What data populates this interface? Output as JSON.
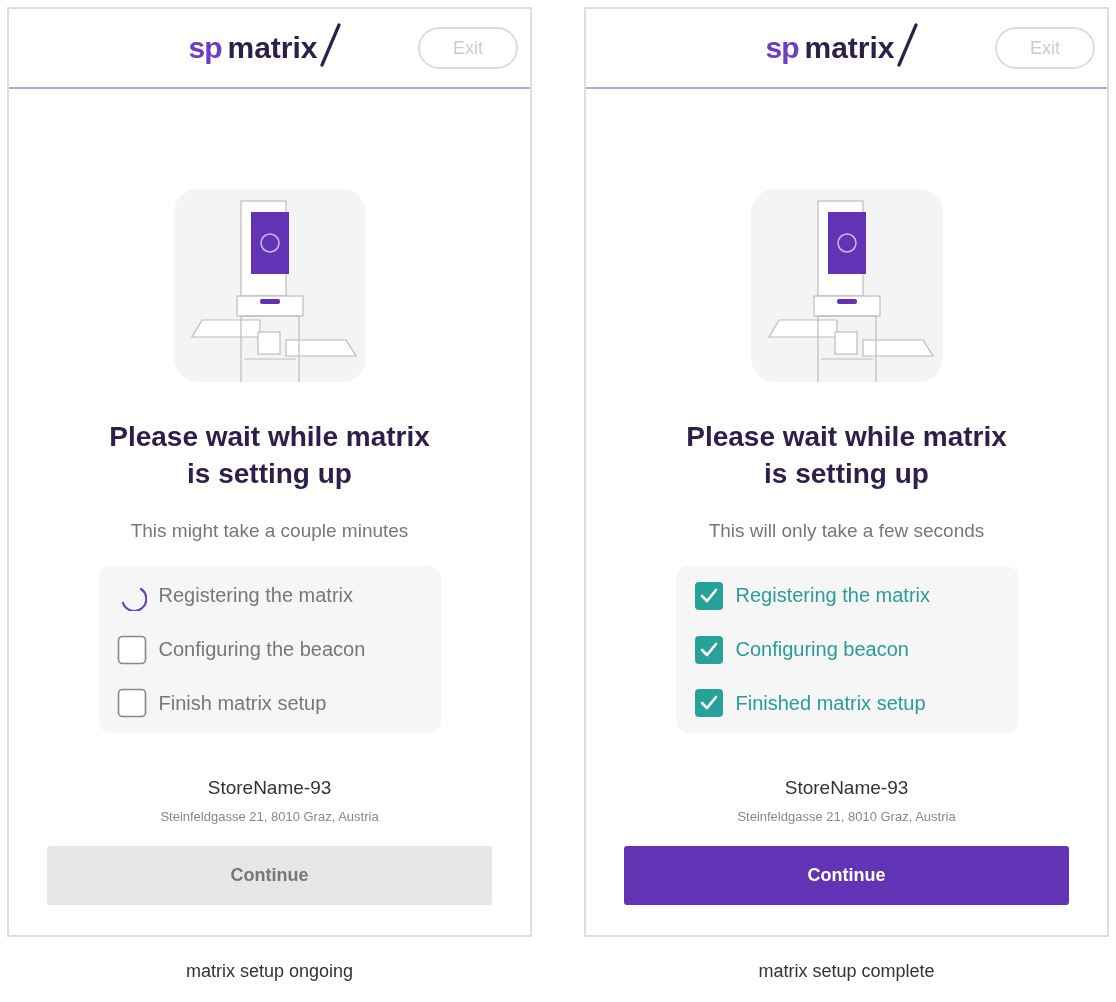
{
  "screens": [
    {
      "logo": {
        "brand": "sp",
        "name": "matrix"
      },
      "exit_button": {
        "label": "Exit",
        "disabled": true
      },
      "title": "Please wait while matrix is setting up",
      "subtitle": "This might take a couple minutes",
      "steps": [
        {
          "label": "Registering the matrix",
          "kind": "spinner",
          "checked": false
        },
        {
          "label": "Configuring the beacon",
          "kind": "checkbox",
          "checked": false
        },
        {
          "label": "Finish matrix setup",
          "kind": "checkbox",
          "checked": false
        }
      ],
      "store_name": "StoreName-93",
      "address": "Steinfeldgasse 21, 8010 Graz, Austria",
      "continue_button": {
        "label": "Continue",
        "disabled": true
      },
      "caption": "matrix setup ongoing"
    },
    {
      "logo": {
        "brand": "sp",
        "name": "matrix"
      },
      "exit_button": {
        "label": "Exit",
        "disabled": true
      },
      "title": "Please wait while matrix is setting up",
      "subtitle": "This will only take a few seconds",
      "steps": [
        {
          "label": "Registering the matrix",
          "kind": "checkbox",
          "checked": true
        },
        {
          "label": "Configuring beacon",
          "kind": "checkbox",
          "checked": true
        },
        {
          "label": "Finished matrix setup",
          "kind": "checkbox",
          "checked": true
        }
      ],
      "store_name": "StoreName-93",
      "address": "Steinfeldgasse 21, 8010 Graz, Austria",
      "continue_button": {
        "label": "Continue",
        "disabled": false
      },
      "caption": "matrix setup complete"
    }
  ]
}
